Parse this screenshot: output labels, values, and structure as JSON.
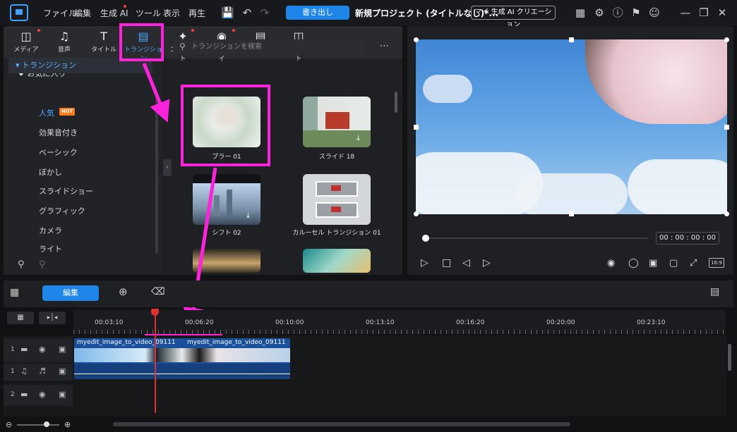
{
  "menu": [
    "ファイル",
    "編集",
    "生成 AI",
    "ツール",
    "表示",
    "再生"
  ],
  "toolbar": {
    "export_label": "書き出し",
    "project_title": "新規プロジェクト (タイトルなし)*...",
    "ai_creation_label": "マイ 生成 AI クリエーション"
  },
  "library_tabs": [
    {
      "label": "メディア",
      "icon": "media-icon"
    },
    {
      "label": "音声",
      "icon": "music-icon"
    },
    {
      "label": "タイトル",
      "icon": "title-icon"
    },
    {
      "label": "トランジション",
      "icon": "transition-icon"
    },
    {
      "label": "エフェクト",
      "icon": "effect-icon"
    },
    {
      "label": "オーバーレイ",
      "icon": "overlay-icon"
    },
    {
      "label": "字幕",
      "icon": "subtitle-icon"
    },
    {
      "label": "テンプレート",
      "icon": "template-icon"
    }
  ],
  "sidebar": {
    "favorites": "お気に入り",
    "section": "トランジション",
    "items": [
      "人気",
      "効果音付き",
      "ベーシック",
      "ぼかし",
      "スライドショー",
      "グラフィック",
      "カメラ",
      "ライト"
    ],
    "hot_badge": "HOT"
  },
  "search": {
    "placeholder": "トランジションを検索"
  },
  "transitions": [
    {
      "label": "ブラー 01"
    },
    {
      "label": "スライド 18"
    },
    {
      "label": "シフト 02"
    },
    {
      "label": "カルーセル トランジション 01"
    }
  ],
  "preview": {
    "timecode": "00 : 00 : 00 : 00",
    "aspect": "16:9"
  },
  "timeline": {
    "edit_label": "編集",
    "ticks": [
      "00:03:10",
      "00:06:20",
      "00:10:00",
      "00:13:10",
      "00:16:20",
      "00:20:00",
      "00:23:10"
    ],
    "clip_a": "myedit_image_to_video_09111",
    "clip_b": "myedit_image_to_video_09111",
    "tracks": [
      "1",
      "1",
      "2"
    ]
  },
  "colors": {
    "accent": "#1e86e8",
    "highlight": "#ff22dd",
    "playhead": "#e03030"
  }
}
